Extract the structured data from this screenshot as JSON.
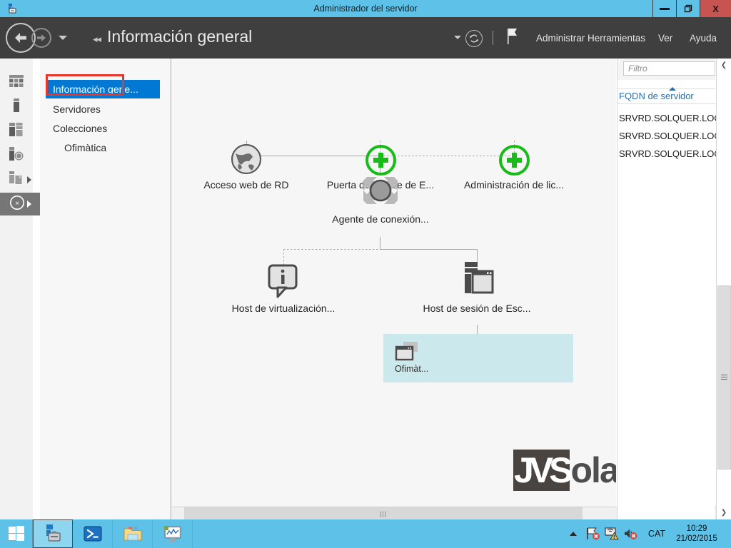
{
  "window": {
    "title": "Administrador del servidor",
    "icon": "server-manager-icon",
    "controls": {
      "minimize": "–",
      "restore": "❐",
      "close": "X"
    }
  },
  "header": {
    "back_icon": "back-arrow-icon",
    "forward_icon": "forward-arrow-icon",
    "dropdown_icon": "chevron-down-icon",
    "breadcrumb_prefix": "◂◂",
    "title": "Información general",
    "toolbar": {
      "notifications_caret": "chevron-down-icon",
      "refresh_icon": "refresh-icon",
      "flag_icon": "flag-icon"
    },
    "menu": [
      {
        "label": "Administrar",
        "name": "menu-administrar"
      },
      {
        "label": "Herramientas",
        "name": "menu-herramientas"
      },
      {
        "label": "Ver",
        "name": "menu-ver"
      },
      {
        "label": "Ayuda",
        "name": "menu-ayuda"
      }
    ]
  },
  "rail": {
    "items": [
      {
        "name": "rail-dashboard",
        "icon": "dashboard-grid-icon",
        "expandable": false,
        "selected": false
      },
      {
        "name": "rail-local-server",
        "icon": "local-server-icon",
        "expandable": false,
        "selected": false
      },
      {
        "name": "rail-all-servers",
        "icon": "all-servers-icon",
        "expandable": false,
        "selected": false
      },
      {
        "name": "rail-ad-ds",
        "icon": "ad-ds-icon",
        "expandable": false,
        "selected": false
      },
      {
        "name": "rail-file-services",
        "icon": "file-services-icon",
        "expandable": true,
        "selected": false
      },
      {
        "name": "rail-remote-desktop-services",
        "icon": "rds-icon",
        "expandable": true,
        "selected": true
      }
    ]
  },
  "sidebar": {
    "items": [
      {
        "label": "Información gene...",
        "name": "sidebar-item-informacion-general",
        "active": true,
        "sub": false
      },
      {
        "label": "Servidores",
        "name": "sidebar-item-servidores",
        "active": false,
        "sub": false
      },
      {
        "label": "Colecciones",
        "name": "sidebar-item-colecciones",
        "active": false,
        "sub": false
      },
      {
        "label": "Ofimàtica",
        "name": "sidebar-item-ofimatica",
        "active": false,
        "sub": true,
        "highlighted": true
      }
    ],
    "highlight_color": "#e8382c",
    "active_color": "#0078d4"
  },
  "deployment": {
    "nodes": [
      {
        "name": "node-rd-web-access",
        "label": "Acceso web de RD",
        "icon": "globe-icon",
        "status": "installed"
      },
      {
        "name": "node-rd-gateway",
        "label": "Puerta de enlace de E...",
        "icon": "plus-circle-icon",
        "status": "not-installed"
      },
      {
        "name": "node-rd-licensing",
        "label": "Administración de lic...",
        "icon": "plus-circle-icon",
        "status": "not-installed"
      },
      {
        "name": "node-rd-connection-broker",
        "label": "Agente de conexión...",
        "icon": "connection-broker-icon",
        "status": "installed"
      },
      {
        "name": "node-rd-virtualization-host",
        "label": "Host de virtualización...",
        "icon": "info-callout-icon",
        "status": "info"
      },
      {
        "name": "node-rd-session-host",
        "label": "Host de sesión de Esc...",
        "icon": "session-host-icon",
        "status": "installed"
      }
    ],
    "collection": {
      "name": "collection-ofimatica",
      "label": "Ofimàt...",
      "icon": "collection-windows-icon",
      "background": "#cbe9ec"
    },
    "plus_color": "#18bc18"
  },
  "watermark": {
    "dark_part": "JVS",
    "light_part": "olanes"
  },
  "right_panel": {
    "filter_placeholder": "Filtro",
    "column_header": "FQDN de servidor",
    "sort_icon": "sort-ascending-icon",
    "rows": [
      "SRVRD.SOLQUER.LOCA",
      "SRVRD.SOLQUER.LOCA",
      "SRVRD.SOLQUER.LOCA"
    ]
  },
  "scrollbars": {
    "h_left_icon": "chevron-left-icon",
    "h_right_icon": "chevron-right-icon",
    "h_grip": "|||",
    "v_up_icon": "chevron-up-icon",
    "v_down_icon": "chevron-down-icon"
  },
  "taskbar": {
    "start": {
      "name": "start-button",
      "icon": "windows-logo-icon"
    },
    "apps": [
      {
        "name": "taskbar-server-manager",
        "icon": "server-manager-icon",
        "active": true
      },
      {
        "name": "taskbar-powershell",
        "icon": "powershell-icon",
        "active": false
      },
      {
        "name": "taskbar-file-explorer",
        "icon": "folder-icon",
        "active": false
      },
      {
        "name": "taskbar-performance-monitor",
        "icon": "performance-monitor-icon",
        "active": false
      }
    ],
    "tray": {
      "expand_icon": "chevron-up-icon",
      "icons": [
        {
          "name": "network-error-icon",
          "icon": "network-flag-error-icon"
        },
        {
          "name": "network-warning-icon",
          "icon": "network-warning-icon"
        },
        {
          "name": "volume-muted-icon",
          "icon": "speaker-muted-icon"
        }
      ],
      "language": "CAT",
      "time": "10:29",
      "date": "21/02/2015"
    }
  }
}
